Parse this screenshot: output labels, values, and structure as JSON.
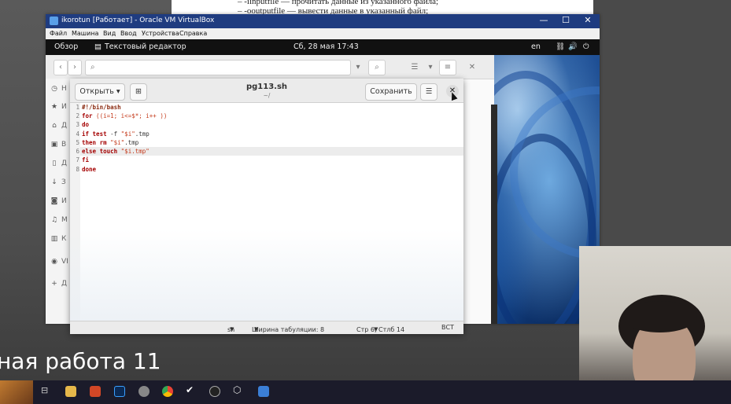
{
  "document_strip": {
    "line1": "–  -iinputfile — прочитать данные из указанного файла;",
    "line2": "–  -ooutputfile — вывести данные в указанный файл;"
  },
  "vbox": {
    "title": "ikorotun [Работает] - Oracle VM VirtualBox",
    "controls": {
      "minimize": "—",
      "maximize": "☐",
      "close": "✕"
    },
    "menu": [
      "Файл",
      "Машина",
      "Вид",
      "Ввод",
      "Устройства",
      "Справка"
    ]
  },
  "gnome_topbar": {
    "overview": "Обзор",
    "app_name": "Текстовый редактор",
    "clock": "Сб, 28 мая  17:43",
    "lang": "en"
  },
  "files": {
    "sidebar_letters": [
      "Н",
      "И",
      "Д",
      "В",
      "Д",
      "З",
      "И",
      "М",
      "К",
      "VI",
      "Д"
    ]
  },
  "gedit": {
    "open_label": "Открыть",
    "new_tab_glyph": "⊞",
    "title": "pg113.sh",
    "subtitle": "~/",
    "save_label": "Сохранить",
    "menu_glyph": "☰",
    "close_glyph": "✕",
    "line_numbers": [
      "1",
      "2",
      "3",
      "4",
      "5",
      "6",
      "7",
      "8"
    ],
    "code": {
      "l1": "#!/bin/bash",
      "l2_kw": "for",
      "l2_rest": " ((i=1; i<=$*; i++ ))",
      "l3": "do",
      "l4_kw": "if",
      "l4_kw2": "test",
      "l4_flag": " -f ",
      "l4_str": "\"$i\"",
      "l4_rest": ".tmp",
      "l5_kw": "then",
      "l5_kw2": "rm",
      "l5_str": " \"$i\"",
      "l5_rest": ".tmp",
      "l6_kw": "else",
      "l6_kw2": "touch",
      "l6_str": " \"$i.tmp\"",
      "l7": "fi",
      "l8": "done"
    },
    "status": {
      "lang": "sh",
      "tab_width": "Ширина табуляции: 8",
      "position": "Стр 6, Стлб 14",
      "mode": "ВСТ"
    }
  },
  "caption": "ная работа 11",
  "colors": {
    "vbox_title": "#1f3c80",
    "keyword": "#a40000",
    "string": "#c4391a"
  }
}
